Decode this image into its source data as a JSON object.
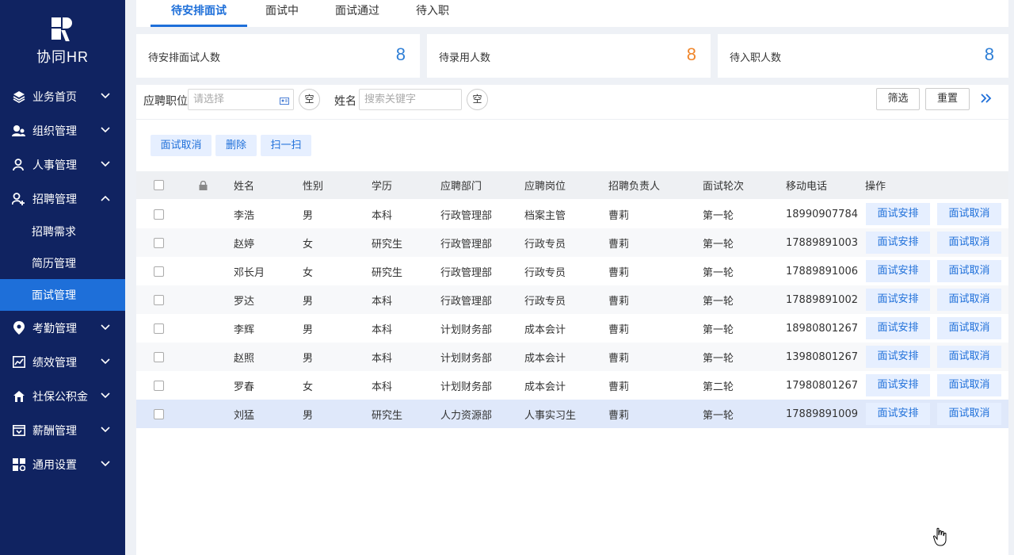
{
  "app": {
    "logo_text": "协同HR"
  },
  "sidebar": {
    "items": [
      {
        "label": "业务首页",
        "icon": "layers-icon",
        "arrow": "down"
      },
      {
        "label": "组织管理",
        "icon": "organization-icon",
        "arrow": "down"
      },
      {
        "label": "人事管理",
        "icon": "person-icon",
        "arrow": "down"
      },
      {
        "label": "招聘管理",
        "icon": "person-add-icon",
        "arrow": "up"
      }
    ],
    "sub_items": [
      {
        "label": "招聘需求"
      },
      {
        "label": "简历管理"
      },
      {
        "label": "面试管理",
        "active": true
      }
    ],
    "items_after": [
      {
        "label": "考勤管理",
        "icon": "location-pin-icon"
      },
      {
        "label": "绩效管理",
        "icon": "chart-icon"
      },
      {
        "label": "社保公积金",
        "icon": "house-icon"
      },
      {
        "label": "薪酬管理",
        "icon": "wallet-icon"
      },
      {
        "label": "通用设置",
        "icon": "grid-settings-icon"
      }
    ],
    "colors": {
      "background": "#102361",
      "active": "#1e6fd9"
    }
  },
  "tabs": [
    {
      "label": "待安排面试",
      "active": true
    },
    {
      "label": "面试中"
    },
    {
      "label": "面试通过"
    },
    {
      "label": "待入职"
    }
  ],
  "stats": [
    {
      "label": "待安排面试人数",
      "value": "8",
      "color": "#2f7fd6"
    },
    {
      "label": "待录用人数",
      "value": "8",
      "color": "#f0862b"
    },
    {
      "label": "待入职人数",
      "value": "8",
      "color": "#2f7fd6"
    }
  ],
  "filters": {
    "position_label": "应聘职位",
    "position_placeholder": "请选择",
    "position_clear": "空",
    "name_label": "姓名",
    "name_placeholder": "搜索关键字",
    "name_clear": "空",
    "filter_button": "筛选",
    "reset_button": "重置",
    "expand_icon": "double-chevron-right-icon"
  },
  "actions": [
    "面试取消",
    "删除",
    "扫一扫"
  ],
  "table": {
    "headers": [
      "姓名",
      "性别",
      "学历",
      "应聘部门",
      "应聘岗位",
      "招聘负责人",
      "面试轮次",
      "移动电话",
      "操作"
    ],
    "row_buttons": [
      "面试安排",
      "面试取消"
    ],
    "rows": [
      [
        "李浩",
        "男",
        "本科",
        "行政管理部",
        "档案主管",
        "曹莉",
        "第一轮",
        "18990907784"
      ],
      [
        "赵婷",
        "女",
        "研究生",
        "行政管理部",
        "行政专员",
        "曹莉",
        "第一轮",
        "17889891003"
      ],
      [
        "邓长月",
        "女",
        "研究生",
        "行政管理部",
        "行政专员",
        "曹莉",
        "第一轮",
        "17889891006"
      ],
      [
        "罗达",
        "男",
        "本科",
        "行政管理部",
        "行政专员",
        "曹莉",
        "第一轮",
        "17889891002"
      ],
      [
        "李辉",
        "男",
        "本科",
        "计划财务部",
        "成本会计",
        "曹莉",
        "第一轮",
        "18980801267"
      ],
      [
        "赵照",
        "男",
        "本科",
        "计划财务部",
        "成本会计",
        "曹莉",
        "第一轮",
        "13980801267"
      ],
      [
        "罗春",
        "女",
        "本科",
        "计划财务部",
        "成本会计",
        "曹莉",
        "第二轮",
        "17980801267"
      ],
      [
        "刘猛",
        "男",
        "研究生",
        "人力资源部",
        "人事实习生",
        "曹莉",
        "第一轮",
        "17889891009"
      ]
    ]
  }
}
